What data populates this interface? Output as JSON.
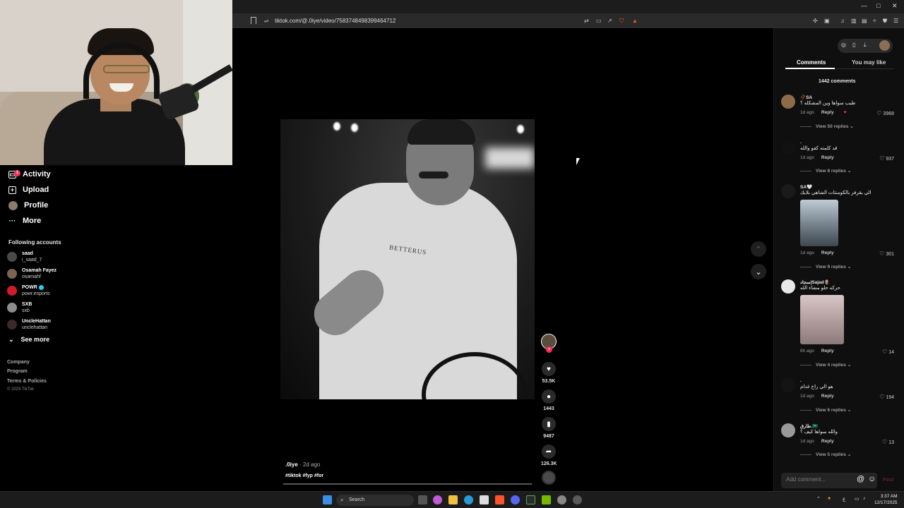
{
  "browser": {
    "url": "tiktok.com/@.0iye/video/7583748498399464712",
    "window_controls": [
      "—",
      "□",
      "✕"
    ]
  },
  "sidebar": {
    "items": [
      {
        "label": "Activity",
        "icon": "inbox-icon",
        "badge": "1"
      },
      {
        "label": "Upload",
        "icon": "plus-square-icon"
      },
      {
        "label": "Profile",
        "icon": "avatar-icon"
      },
      {
        "label": "More",
        "icon": "ellipsis-icon"
      }
    ],
    "following_title": "Following accounts",
    "accounts": [
      {
        "name": "saad",
        "handle": "i_saad_7"
      },
      {
        "name": "Osamah Fayez",
        "handle": "osamahf"
      },
      {
        "name": "POWR",
        "handle": "powr.esports",
        "verified": true
      },
      {
        "name": "SXB",
        "handle": "sxb"
      },
      {
        "name": "UncleHattan",
        "handle": "unclehattan"
      }
    ],
    "see_more": "See more",
    "footer": [
      "Company",
      "Program",
      "Terms & Policies"
    ],
    "copyright": "© 2025 TikTok"
  },
  "video": {
    "shirt_text": "BETTERUS",
    "author": ".0iye",
    "posted": " · 2d ago",
    "tags": "#tiktok #fyp #for",
    "progress": 0.0
  },
  "actions": {
    "likes": "53.5K",
    "comments": "1443",
    "saves": "9487",
    "shares": "126.3K"
  },
  "panel": {
    "tabs": [
      "Comments",
      "You may like"
    ],
    "comment_count": "1442 comments",
    "comments": [
      {
        "user": "🥀SA",
        "text": "طيب سواها وين المشكله ؟",
        "time": "1d ago",
        "reply": "Reply",
        "likes": "3968",
        "view_replies": "View 50 replies"
      },
      {
        "user": ".",
        "text": "قد كلمته كفو والله",
        "time": "1d ago",
        "reply": "Reply",
        "likes": "937",
        "view_replies": "View 8 replies"
      },
      {
        "user": "SA🤍",
        "text": "الي يقرفر بالكومنتات الشاهي بلايك",
        "time": "1d ago",
        "reply": "Reply",
        "likes": "301",
        "view_replies": "View 9 replies"
      },
      {
        "user": "سجاد|Sajad🌷",
        "text": "حركه حلو مشاء الله",
        "time": "6h ago",
        "reply": "Reply",
        "likes": "14",
        "view_replies": "View 4 replies"
      },
      {
        "user": ".",
        "text": "هو الي راح غدام",
        "time": "1d ago",
        "reply": "Reply",
        "likes": "194",
        "view_replies": "View 6 replies"
      },
      {
        "user": "طارق.🇸🇦",
        "text": "والله سواها كيف ؟",
        "time": "1d ago",
        "reply": "Reply",
        "likes": "13",
        "view_replies": "View 5 replies"
      }
    ],
    "add_comment_placeholder": "Add comment...",
    "post_label": "Post"
  },
  "taskbar": {
    "search_label": "Search",
    "time": "3:37 AM",
    "date": "12/17/2025",
    "lang": "ع"
  }
}
